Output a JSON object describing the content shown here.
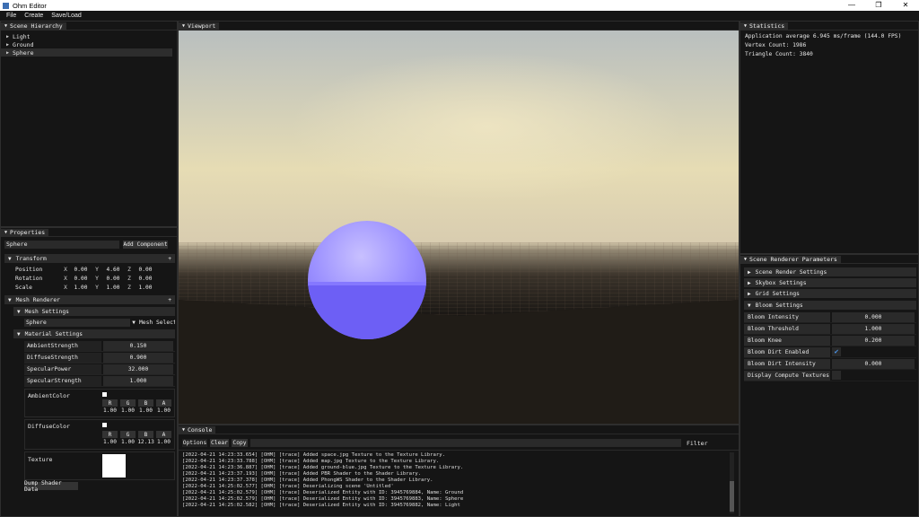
{
  "window": {
    "title": "Ohm Editor",
    "min": "—",
    "max": "❐",
    "close": "✕"
  },
  "menu": [
    "File",
    "Create",
    "Save/Load"
  ],
  "hierarchy": {
    "title": "Scene Hierarchy",
    "items": [
      "Light",
      "Ground",
      "Sphere"
    ]
  },
  "properties": {
    "title": "Properties",
    "entity_name": "Sphere",
    "add_component": "Add Component",
    "transform": {
      "title": "Transform",
      "plus": "+",
      "rows": [
        {
          "label": "Position",
          "x": "0.00",
          "y": "4.60",
          "z": "0.00"
        },
        {
          "label": "Rotation",
          "x": "0.00",
          "y": "0.00",
          "z": "0.00"
        },
        {
          "label": "Scale",
          "x": "1.00",
          "y": "1.00",
          "z": "1.00"
        }
      ],
      "axis": {
        "x": "X",
        "y": "Y",
        "z": "Z"
      }
    },
    "mesh_renderer": {
      "title": "Mesh Renderer",
      "plus": "+"
    },
    "mesh_settings": {
      "title": "Mesh Settings",
      "mesh": "Sphere",
      "mesh_select": "Mesh Select"
    },
    "material": {
      "title": "Material Settings",
      "fields": [
        {
          "label": "AmbientStrength",
          "value": "0.150"
        },
        {
          "label": "DiffuseStrength",
          "value": "0.900"
        },
        {
          "label": "SpecularPower",
          "value": "32.000"
        },
        {
          "label": "SpecularStrength",
          "value": "1.000"
        }
      ],
      "ambient": {
        "label": "AmbientColor",
        "headers": [
          "R",
          "G",
          "B",
          "A"
        ],
        "values": [
          "1.00",
          "1.00",
          "1.00",
          "1.00"
        ]
      },
      "diffuse": {
        "label": "DiffuseColor",
        "headers": [
          "R",
          "G",
          "B",
          "A"
        ],
        "values": [
          "1.00",
          "1.00",
          "12.13",
          "1.00"
        ]
      },
      "texture": "Texture",
      "dump": "Dump Shader Data"
    }
  },
  "viewport": {
    "title": "Viewport"
  },
  "console": {
    "title": "Console",
    "options": "Options",
    "clear": "Clear",
    "copy": "Copy",
    "filter": "Filter",
    "lines": [
      "[2022-04-21 14:23:33.654] [OHM] [trace] Added space.jpg Texture to the Texture Library.",
      "[2022-04-21 14:23:33.788] [OHM] [trace] Added map.jpg Texture to the Texture Library.",
      "[2022-04-21 14:23:36.887] [OHM] [trace] Added ground-blue.jpg Texture to the Texture Library.",
      "[2022-04-21 14:23:37.193] [OHM] [trace] Added PBR Shader to the Shader Library.",
      "[2022-04-21 14:23:37.378] [OHM] [trace] Added PhongWS Shader to the Shader Library.",
      "[2022-04-21 14:25:02.577] [OHM] [trace] Deserializing scene 'Untitled'",
      "[2022-04-21 14:25:02.579] [OHM] [trace] Deserialized Entity with ID: 3945769884, Name: Ground",
      "[2022-04-21 14:25:02.579] [OHM] [trace] Deserialized Entity with ID: 3945769883, Name: Sphere",
      "[2022-04-21 14:25:02.582] [OHM] [trace] Deserialized Entity with ID: 3945769882, Name: Light"
    ]
  },
  "statistics": {
    "title": "Statistics",
    "lines": [
      "Application average 6.945 ms/frame (144.0 FPS)",
      "Vertex Count: 1986",
      "Triangle Count: 3840"
    ]
  },
  "scene_renderer": {
    "title": "Scene Renderer Parameters",
    "sections": [
      "Scene Render Settings",
      "Skybox Settings",
      "Grid Settings"
    ],
    "bloom": {
      "title": "Bloom Settings",
      "rows": [
        {
          "label": "Bloom Intensity",
          "value": "0.000",
          "kind": "num"
        },
        {
          "label": "Bloom Threshold",
          "value": "1.000",
          "kind": "num"
        },
        {
          "label": "Bloom Knee",
          "value": "0.200",
          "kind": "num"
        },
        {
          "label": "Bloom Dirt Enabled",
          "value": "✔",
          "kind": "check"
        },
        {
          "label": "Bloom Dirt Intensity",
          "value": "0.000",
          "kind": "num"
        },
        {
          "label": "Display Compute Textures",
          "value": "",
          "kind": "check"
        }
      ]
    }
  },
  "colors": {
    "accent": "#3d6fb3",
    "sphere": "#8a7bff",
    "sky_top": "#b9bfbf",
    "sky_bottom": "#e6dcb4",
    "ground": "#201c17"
  }
}
